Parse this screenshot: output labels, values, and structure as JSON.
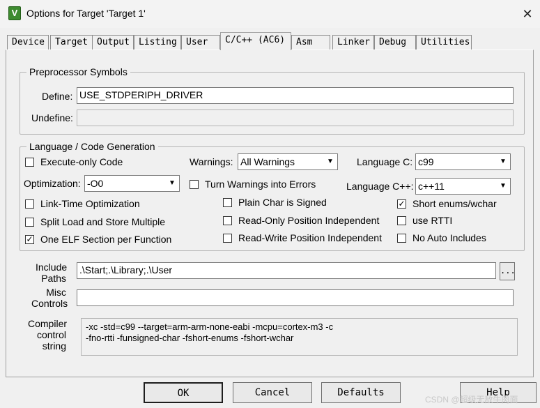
{
  "window": {
    "title": "Options for Target 'Target 1'",
    "close_glyph": "✕",
    "app_icon": "V"
  },
  "tabs": [
    {
      "label": "Device",
      "active": false
    },
    {
      "label": "Target",
      "active": false
    },
    {
      "label": "Output",
      "active": false
    },
    {
      "label": "Listing",
      "active": false
    },
    {
      "label": "User",
      "active": false
    },
    {
      "label": "C/C++ (AC6)",
      "active": true
    },
    {
      "label": "Asm",
      "active": false
    },
    {
      "label": "Linker",
      "active": false
    },
    {
      "label": "Debug",
      "active": false
    },
    {
      "label": "Utilities",
      "active": false
    }
  ],
  "preprocessor": {
    "legend": "Preprocessor Symbols",
    "define_label": "Define:",
    "define_value": "USE_STDPERIPH_DRIVER",
    "undefine_label": "Undefine:",
    "undefine_value": ""
  },
  "language": {
    "legend": "Language / Code Generation",
    "warnings_label": "Warnings:",
    "warnings_value": "All Warnings",
    "language_c_label": "Language C:",
    "language_c_value": "c99",
    "optimization_label": "Optimization:",
    "optimization_value": "-O0",
    "language_cpp_label": "Language C++:",
    "language_cpp_value": "c++11",
    "checkboxes": {
      "execute_only": {
        "label": "Execute-only Code",
        "checked": false
      },
      "turn_warnings": {
        "label": "Turn Warnings into Errors",
        "checked": false
      },
      "link_time": {
        "label": "Link-Time Optimization",
        "checked": false
      },
      "plain_char": {
        "label": "Plain Char is Signed",
        "checked": false
      },
      "short_enums": {
        "label": "Short enums/wchar",
        "checked": true
      },
      "split_load": {
        "label": "Split Load and Store Multiple",
        "checked": false
      },
      "ropi": {
        "label": "Read-Only Position Independent",
        "checked": false
      },
      "rtti": {
        "label": "use RTTI",
        "checked": false
      },
      "one_elf": {
        "label": "One ELF Section per Function",
        "checked": true
      },
      "rwpi": {
        "label": "Read-Write Position Independent",
        "checked": false
      },
      "no_auto": {
        "label": "No Auto Includes",
        "checked": false
      }
    }
  },
  "include": {
    "label_line1": "Include",
    "label_line2": "Paths",
    "value": ".\\Start;.\\Library;.\\User",
    "browse_label": "..."
  },
  "misc": {
    "label_line1": "Misc",
    "label_line2": "Controls",
    "value": ""
  },
  "compiler": {
    "label_line1": "Compiler",
    "label_line2": "control",
    "label_line3": "string",
    "value": "-xc -std=c99 --target=arm-arm-none-eabi -mcpu=cortex-m3 -c\n-fno-rtti -funsigned-char -fshort-enums -fshort-wchar"
  },
  "buttons": {
    "ok": "OK",
    "cancel": "Cancel",
    "defaults": "Defaults",
    "help": "Help"
  },
  "watermark": "CSDN @超级无敌牛肉面"
}
